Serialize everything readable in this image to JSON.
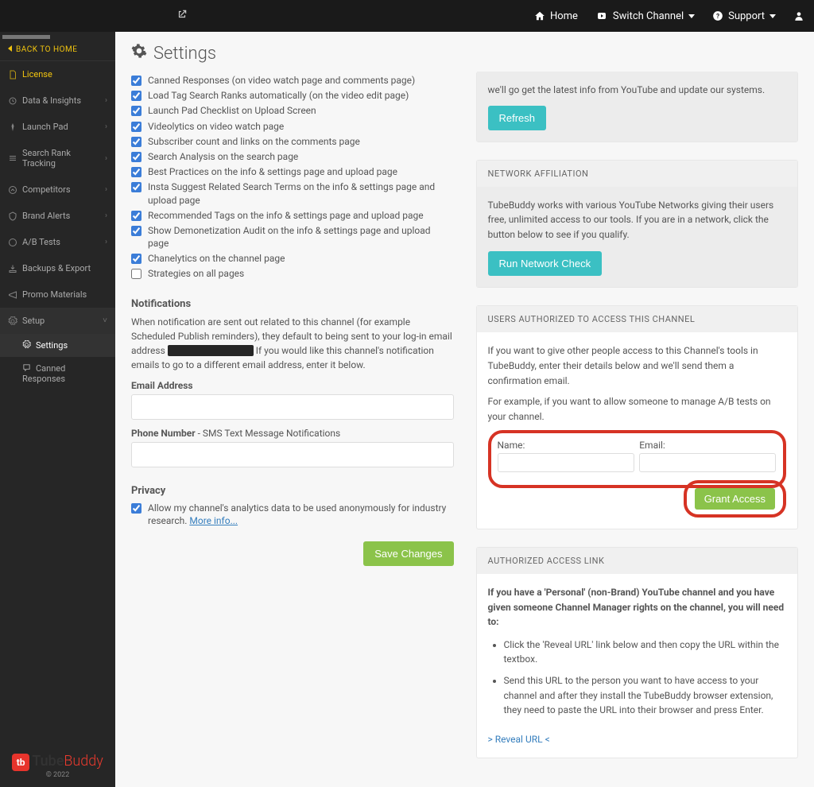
{
  "topnav": {
    "home": "Home",
    "switch": "Switch Channel",
    "support": "Support"
  },
  "sidebar": {
    "back": "BACK TO HOME",
    "items": [
      {
        "label": "License",
        "gold": true
      },
      {
        "label": "Data & Insights",
        "chev": true
      },
      {
        "label": "Launch Pad",
        "chev": true
      },
      {
        "label": "Search Rank Tracking",
        "chev": true
      },
      {
        "label": "Competitors",
        "chev": true
      },
      {
        "label": "Brand Alerts",
        "chev": true
      },
      {
        "label": "A/B Tests",
        "chev": true
      },
      {
        "label": "Backups & Export"
      },
      {
        "label": "Promo Materials"
      },
      {
        "label": "Setup",
        "chev": true,
        "open": true
      }
    ],
    "sub": [
      "Settings",
      "Canned Responses"
    ],
    "logo1": "Tube",
    "logo2": "Buddy",
    "copy": "© 2022"
  },
  "page": {
    "title": "Settings"
  },
  "checks": [
    {
      "label": "Canned Responses (on video watch page and comments page)",
      "checked": true
    },
    {
      "label": "Load Tag Search Ranks automatically (on the video edit page)",
      "checked": true
    },
    {
      "label": "Launch Pad Checklist on Upload Screen",
      "checked": true
    },
    {
      "label": "Videolytics on video watch page",
      "checked": true
    },
    {
      "label": "Subscriber count and links on the comments page",
      "checked": true
    },
    {
      "label": "Search Analysis on the search page",
      "checked": true
    },
    {
      "label": "Best Practices on the info & settings page and upload page",
      "checked": true
    },
    {
      "label": "Insta Suggest Related Search Terms on the info & settings page and upload page",
      "checked": true
    },
    {
      "label": "Recommended Tags on the info & settings page and upload page",
      "checked": true
    },
    {
      "label": "Show Demonetization Audit on the info & settings page and upload page",
      "checked": true
    },
    {
      "label": "Chanelytics on the channel page",
      "checked": true
    },
    {
      "label": "Strategies on all pages",
      "checked": false
    }
  ],
  "notif": {
    "heading": "Notifications",
    "text1": "When notification are sent out related to this channel (for example Scheduled Publish reminders), they default to being sent to your log-in email address ",
    "text2": " If you would like this channel's notification emails to go to a different email address, enter it below.",
    "email_label": "Email Address",
    "phone_label": "Phone Number",
    "phone_sub": " - SMS Text Message Notifications"
  },
  "privacy": {
    "heading": "Privacy",
    "check": "Allow my channel's analytics data to be used anonymously for industry research.   ",
    "more": "More info...",
    "save": "Save Changes"
  },
  "right": {
    "trail": "we'll go get the latest info from YouTube and update our systems.",
    "refresh": "Refresh",
    "net_h": "NETWORK AFFILIATION",
    "net_t": "TubeBuddy works with various YouTube Networks giving their users free, unlimited access to our tools. If you are in a network, click the button below to see if you qualify.",
    "net_btn": "Run Network Check",
    "auth_h": "USERS AUTHORIZED TO ACCESS THIS CHANNEL",
    "auth_t1": "If you want to give other people access to this Channel's tools in TubeBuddy, enter their details below and we'll send them a confirmation email.",
    "auth_t2": "For example, if you want to allow someone to manage A/B tests on your channel.",
    "name_l": "Name:",
    "email_l": "Email:",
    "grant": "Grant Access",
    "link_h": "AUTHORIZED ACCESS LINK",
    "link_bold": "If you have a 'Personal' (non-Brand) YouTube channel and you have given someone Channel Manager rights on the channel, you will need to:",
    "li1": "Click the 'Reveal URL' link below and then copy the URL within the textbox.",
    "li2": "Send this URL to the person you want to have access to your channel and after they install the TubeBuddy browser extension, they need to paste the URL into their browser and press Enter.",
    "reveal": "> Reveal URL <"
  }
}
